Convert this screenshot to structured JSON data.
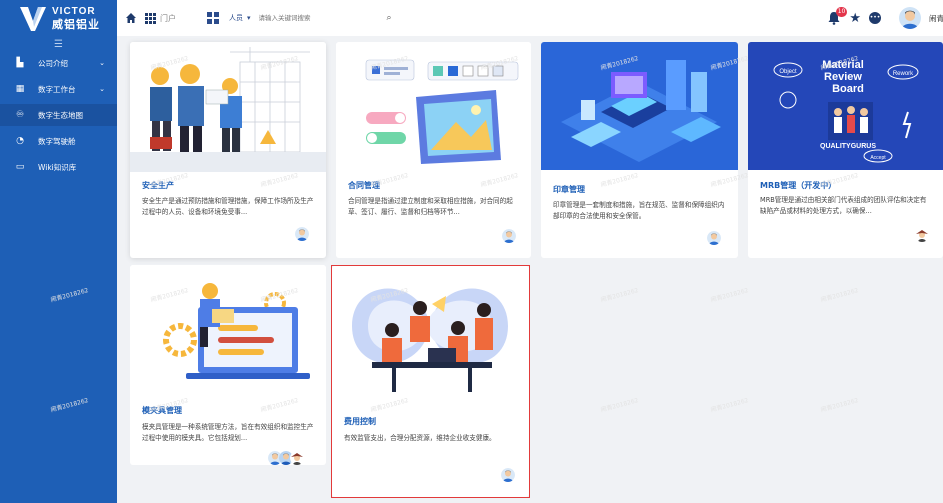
{
  "logo": {
    "en": "VICTOR",
    "cn": "威铝铝业"
  },
  "sidebar": {
    "collapse_icon": "menu-collapse-icon",
    "items": [
      {
        "label": "公司介绍",
        "icon": "building-icon",
        "has_chevron": true
      },
      {
        "label": "数字工作台",
        "icon": "workbench-icon",
        "has_chevron": true
      },
      {
        "label": "数字生态地图",
        "icon": "ecosystem-icon",
        "has_chevron": false,
        "active": true
      },
      {
        "label": "数字驾驶舱",
        "icon": "cockpit-icon",
        "has_chevron": false
      },
      {
        "label": "Wiki知识库",
        "icon": "book-icon",
        "has_chevron": false
      }
    ]
  },
  "topbar": {
    "portal_label": "门户",
    "search_scope": "人员",
    "search_placeholder": "请输入关键词搜索",
    "notification_count": "10",
    "username": "闹青"
  },
  "watermark": "闹青2018262",
  "cards": [
    {
      "title": "安全生产",
      "desc": "安全生产是通过预防措施和管理措施，保障工作场所及生产过程中的人员、设备和环境免受事...",
      "illustration": "construction-workers"
    },
    {
      "title": "合同管理",
      "desc": "合同管理是指通过建立制度和采取相应措施，对合同的起草、签订、履行、监督和归档等环节...",
      "illustration": "document-editing"
    },
    {
      "title": "印章管理",
      "desc": "印章管理是一套制度和措施，旨在规范、监督和保障组织内部印章的合法使用和安全保管。",
      "illustration": "isometric-office"
    },
    {
      "title": "MRB管理（开发中）",
      "desc": "MRB管理是通过由相关部门代表组成的团队评估和决定有缺陷产品或材料的处理方式，以确保...",
      "illustration": "material-review-board",
      "image_text": {
        "line1": "Material",
        "line2": "Review",
        "line3": "Board",
        "object": "Object",
        "rework": "Rework",
        "accept": "Accept",
        "brand": "QUALITYGURUS"
      }
    },
    {
      "title": "模夹具管理",
      "desc": "模夹具管理是一种系统管理方法，旨在有效组织和监控生产过程中使用的模夹具。它包括规划...",
      "illustration": "worker-laptop"
    },
    {
      "title": "费用控制",
      "desc": "有效监管支出，合理分配资源，维持企业收支健康。",
      "illustration": "team-meeting"
    }
  ]
}
